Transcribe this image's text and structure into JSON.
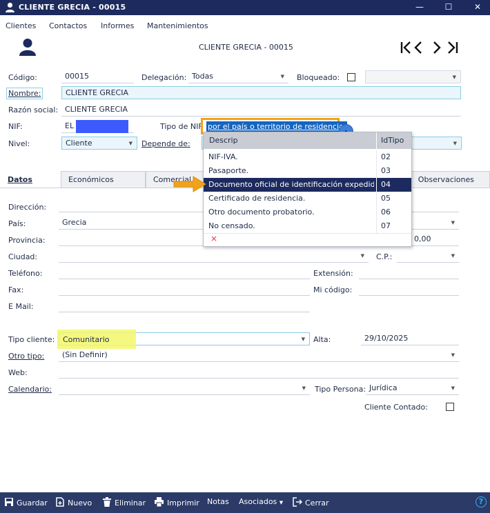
{
  "window": {
    "title": "CLIENTE GRECIA - 00015",
    "minimize": "—",
    "maximize": "☐",
    "close": "✕"
  },
  "menu": [
    "Clientes",
    "Contactos",
    "Informes",
    "Mantenimientos"
  ],
  "header": {
    "record_title": "CLIENTE GRECIA - 00015"
  },
  "form": {
    "codigo_label": "Código:",
    "codigo_value": "00015",
    "delegacion_label": "Delegación:",
    "delegacion_value": "Todas",
    "bloqueado_label": "Bloqueado:",
    "nombre_label": "Nombre:",
    "nombre_value": "CLIENTE GRECIA",
    "razon_label": "Razón social:",
    "razon_value": "CLIENTE GRECIA",
    "nif_label": "NIF:",
    "nif_value": "EL",
    "tiponif_label": "Tipo de NIF:",
    "tiponif_value": "por el país o territorio de residencia.",
    "nivel_label": "Nivel:",
    "nivel_value": "Cliente",
    "depende_label": "Depende de:"
  },
  "tabs": [
    "Datos",
    "Económicos",
    "Comercial",
    "Observaciones"
  ],
  "datos": {
    "direccion_label": "Dirección:",
    "pais_label": "País:",
    "pais_value": "Grecia",
    "provincia_label": "Provincia:",
    "provincia_right_value": "0,00",
    "ciudad_label": "Ciudad:",
    "cp_label": "C.P.:",
    "telefono_label": "Teléfono:",
    "extension_label": "Extensión:",
    "fax_label": "Fax:",
    "micodigo_label": "Mi código:",
    "email_label": "E Mail:",
    "tipocliente_label": "Tipo cliente:",
    "tipocliente_value": "Comunitario",
    "alta_label": "Alta:",
    "alta_value": "29/10/2025",
    "otrotipo_label": "Otro tipo:",
    "otrotipo_value": "(Sin Definir)",
    "web_label": "Web:",
    "calendario_label": "Calendario:",
    "tipopersona_label": "Tipo Persona:",
    "tipopersona_value": "Jurídica",
    "contado_label": "Cliente Contado:"
  },
  "dropdown": {
    "col_descrip": "Descrip",
    "col_idtipo": "IdTipo",
    "rows": [
      {
        "descrip": "NIF-IVA.",
        "id": "02"
      },
      {
        "descrip": "Pasaporte.",
        "id": "03"
      },
      {
        "descrip": "Documento oficial de identificación expedido...",
        "id": "04"
      },
      {
        "descrip": "Certificado de residencia.",
        "id": "05"
      },
      {
        "descrip": "Otro documento probatorio.",
        "id": "06"
      },
      {
        "descrip": "No censado.",
        "id": "07"
      }
    ],
    "selected_index": 2,
    "clear_symbol": "×"
  },
  "toolbar": {
    "guardar": "Guardar",
    "nuevo": "Nuevo",
    "eliminar": "Eliminar",
    "imprimir": "Imprimir",
    "notas": "Notas",
    "asociados": "Asociados",
    "cerrar": "Cerrar",
    "help": "?"
  },
  "colors": {
    "titlebar": "#1c2a5e",
    "highlight_yellow": "#f3f76a",
    "highlight_orange": "#f0a21a",
    "selection_blue": "#1565c0",
    "nif_redaction": "#3d5afe"
  }
}
